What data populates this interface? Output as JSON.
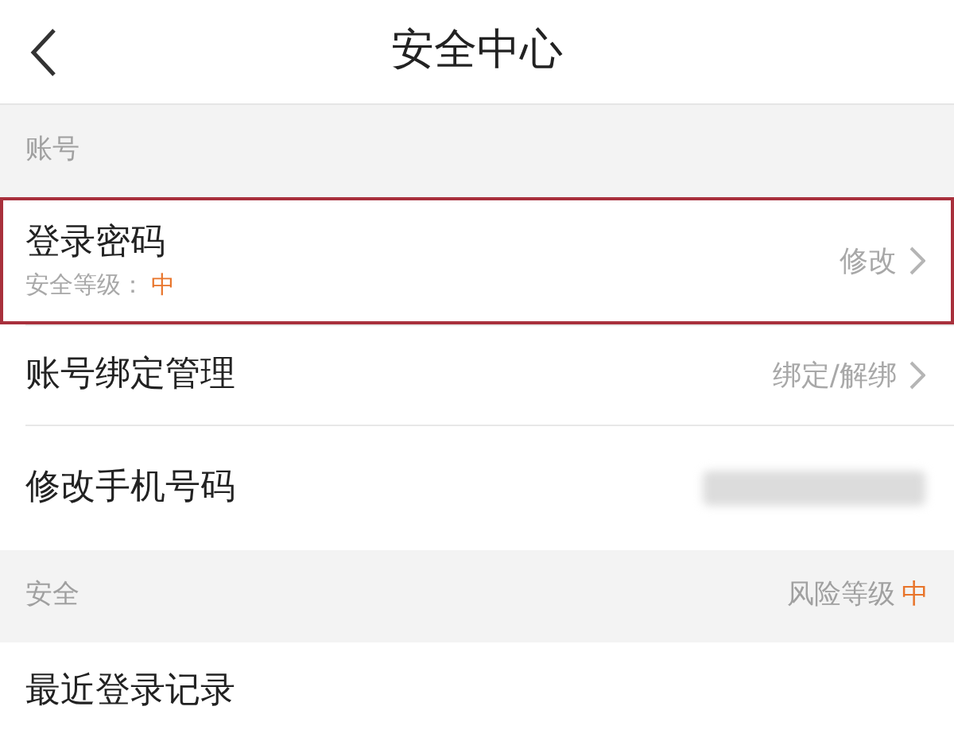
{
  "header": {
    "title": "安全中心"
  },
  "sections": [
    {
      "title": "账号",
      "rows": [
        {
          "kind": "level",
          "label": "登录密码",
          "sub_label": "安全等级：",
          "sub_value": "中",
          "action": "修改",
          "highlighted": true
        },
        {
          "kind": "link",
          "label": "账号绑定管理",
          "action": "绑定/解绑",
          "highlighted": false
        },
        {
          "kind": "blurred",
          "label": "修改手机号码",
          "highlighted": false
        }
      ]
    },
    {
      "title": "安全",
      "right_label": "风险等级",
      "right_value": "中",
      "rows": [
        {
          "kind": "plain",
          "label": "最近登录记录",
          "highlighted": false
        }
      ]
    }
  ]
}
